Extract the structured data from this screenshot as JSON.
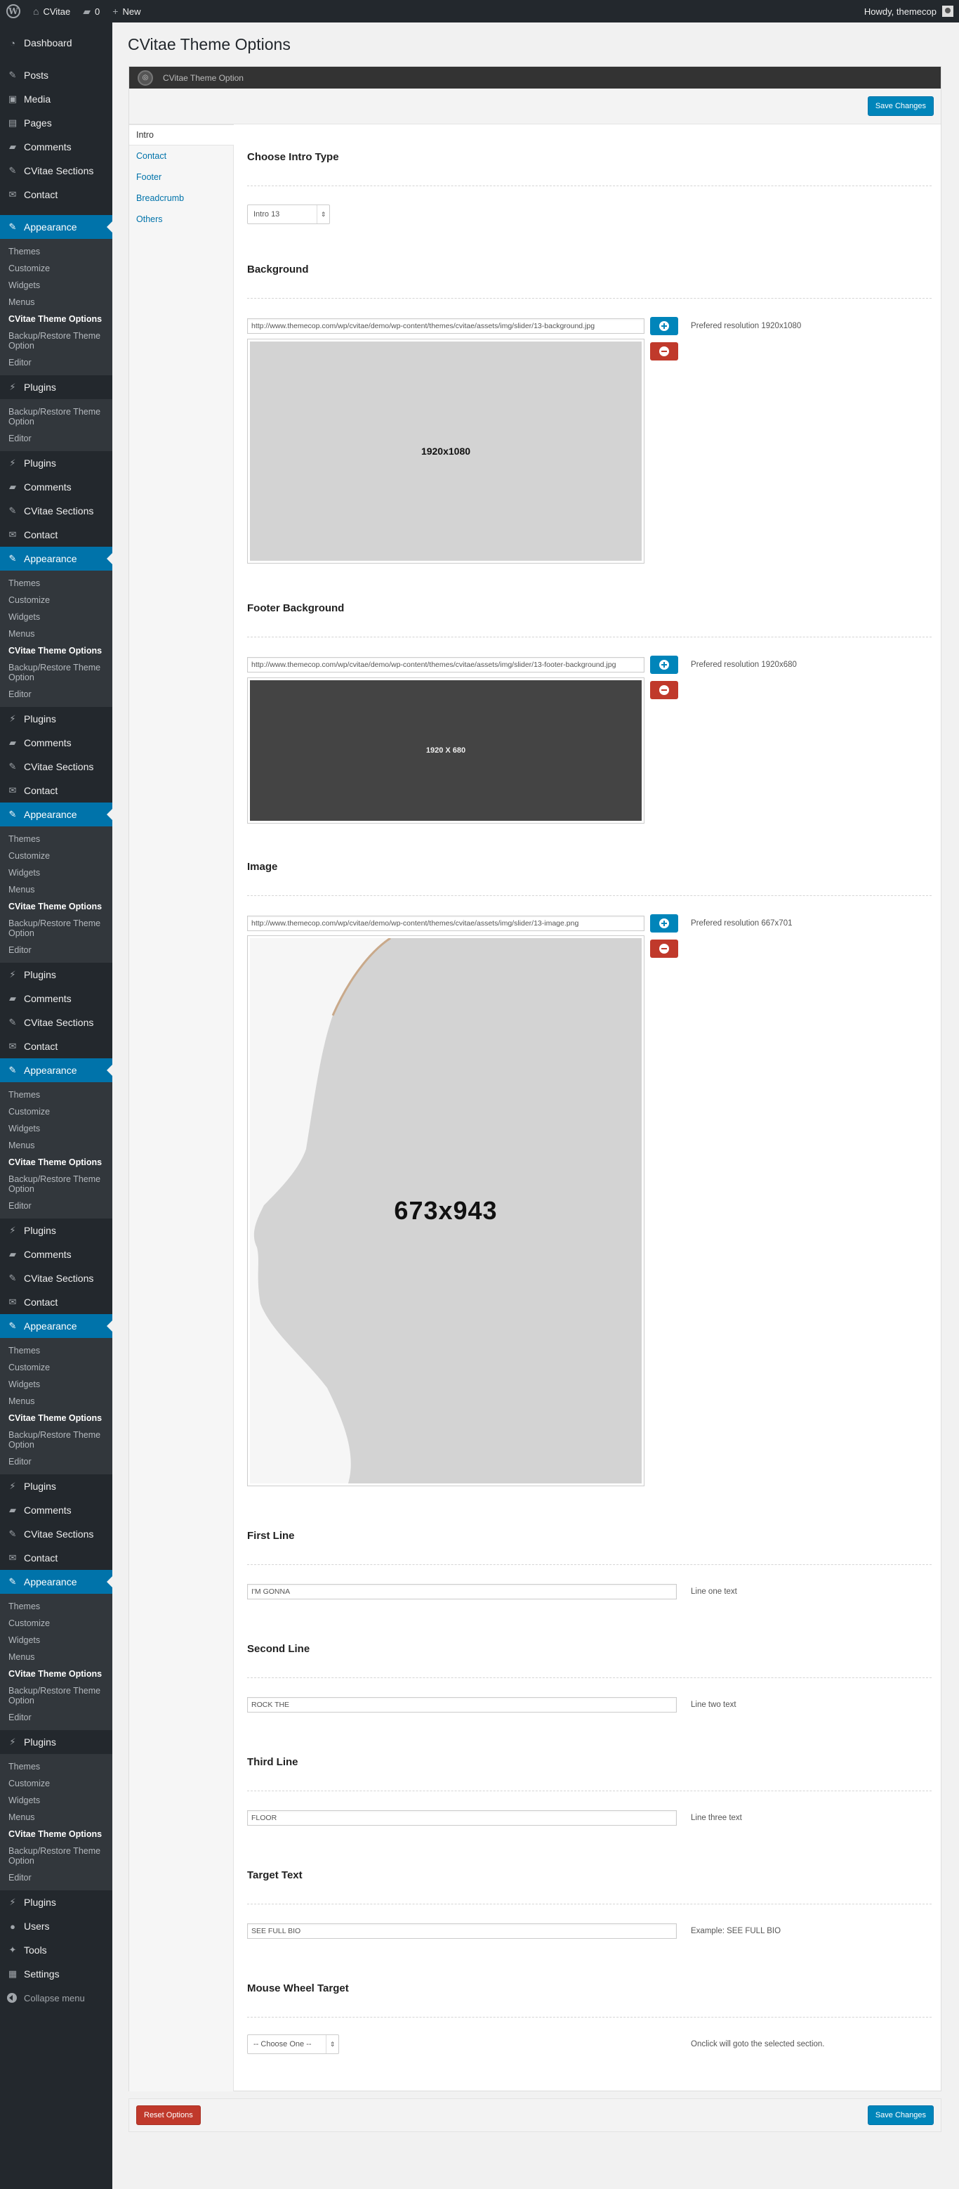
{
  "adminbar": {
    "site_name": "CVitae",
    "comments_count": "0",
    "new_label": "New",
    "howdy": "Howdy, themecop"
  },
  "sidebar": {
    "dashboard": "Dashboard",
    "posts": "Posts",
    "media": "Media",
    "pages": "Pages",
    "comments": "Comments",
    "cvitae_sections": "CVitae Sections",
    "contact": "Contact",
    "appearance": "Appearance",
    "plugins": "Plugins",
    "users": "Users",
    "tools": "Tools",
    "settings": "Settings",
    "collapse": "Collapse menu",
    "appearance_sub": [
      "Themes",
      "Customize",
      "Widgets",
      "Menus",
      "CVitae Theme Options",
      "Backup/Restore Theme Option",
      "Editor"
    ],
    "plugins_sub": [
      "Backup/Restore Theme Option",
      "Editor"
    ],
    "last_sub": [
      "Themes",
      "Customize",
      "Widgets",
      "Menus",
      "CVitae Theme Options",
      "Backup/Restore Theme Option",
      "Editor"
    ]
  },
  "page": {
    "title": "CVitae Theme Options",
    "panel_header": "CVitae Theme Option",
    "save_label": "Save Changes",
    "reset_label": "Reset Options"
  },
  "tabs": [
    "Intro",
    "Contact",
    "Footer",
    "Breadcrumb",
    "Others"
  ],
  "fields": {
    "intro_type": {
      "title": "Choose Intro Type",
      "value": "Intro 13"
    },
    "background": {
      "title": "Background",
      "url": "http://www.themecop.com/wp/cvitae/demo/wp-content/themes/cvitae/assets/img/slider/13-background.jpg",
      "desc": "Prefered resolution 1920x1080",
      "preview_text": "1920x1080"
    },
    "footer_background": {
      "title": "Footer Background",
      "url": "http://www.themecop.com/wp/cvitae/demo/wp-content/themes/cvitae/assets/img/slider/13-footer-background.jpg",
      "desc": "Prefered resolution 1920x680",
      "preview_text": "1920 X 680"
    },
    "image": {
      "title": "Image",
      "url": "http://www.themecop.com/wp/cvitae/demo/wp-content/themes/cvitae/assets/img/slider/13-image.png",
      "desc": "Prefered resolution 667x701",
      "preview_text": "673x943"
    },
    "first_line": {
      "title": "First Line",
      "value": "I'M GONNA",
      "desc": "Line one text"
    },
    "second_line": {
      "title": "Second Line",
      "value": "ROCK THE",
      "desc": "Line two text"
    },
    "third_line": {
      "title": "Third Line",
      "value": "FLOOR",
      "desc": "Line three text"
    },
    "target_text": {
      "title": "Target Text",
      "value": "SEE FULL BIO",
      "desc": "Example: SEE FULL BIO"
    },
    "mouse_wheel": {
      "title": "Mouse Wheel Target",
      "value": "-- Choose One --",
      "desc": "Onclick will goto the selected section."
    }
  },
  "colors": {
    "accent": "#0073aa",
    "button_blue": "#0085ba",
    "button_red": "#c0392b",
    "sidebar_bg": "#23282d",
    "submenu_bg": "#32373c"
  }
}
